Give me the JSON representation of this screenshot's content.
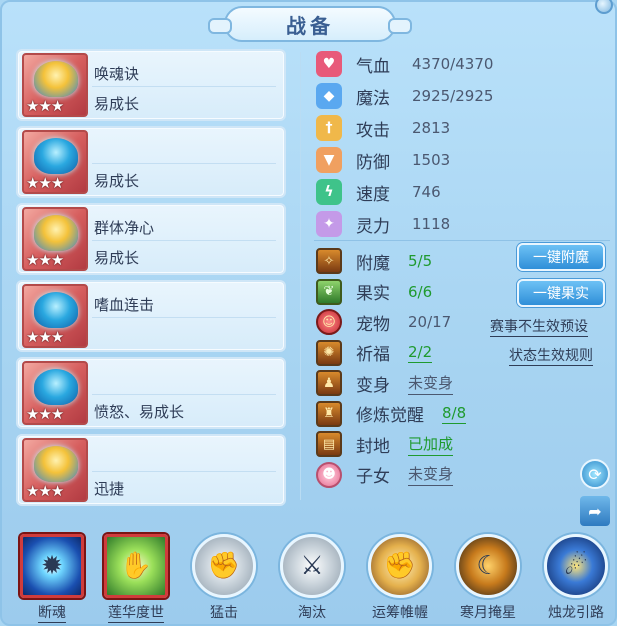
{
  "title": "战备",
  "mounts": [
    {
      "line1": "唤魂诀",
      "line2": "易成长",
      "stars": "★★★",
      "creature": "gold"
    },
    {
      "line1": "",
      "line2": "易成长",
      "stars": "★★★",
      "creature": "blue"
    },
    {
      "line1": "群体净心",
      "line2": "易成长",
      "stars": "★★★",
      "creature": "gold"
    },
    {
      "line1": "嗜血连击",
      "line2": "",
      "stars": "★★★",
      "creature": "blue"
    },
    {
      "line1": "",
      "line2": "愤怒、易成长",
      "stars": "★★★",
      "creature": "blue"
    },
    {
      "line1": "",
      "line2": "迅捷",
      "stars": "★★★",
      "creature": "gold"
    }
  ],
  "stats": [
    {
      "name": "气血",
      "value": "4370/4370",
      "icon": "heart-icon",
      "color": "#e85a7a",
      "glyph": "♥"
    },
    {
      "name": "魔法",
      "value": "2925/2925",
      "icon": "mana-icon",
      "color": "#5aa8f0",
      "glyph": "◆"
    },
    {
      "name": "攻击",
      "value": "2813",
      "icon": "sword-icon",
      "color": "#f0b84a",
      "glyph": "†"
    },
    {
      "name": "防御",
      "value": "1503",
      "icon": "shield-icon",
      "color": "#f0a060",
      "glyph": "▼"
    },
    {
      "name": "速度",
      "value": "746",
      "icon": "speed-icon",
      "color": "#3fc38a",
      "glyph": "ϟ"
    },
    {
      "name": "灵力",
      "value": "1118",
      "icon": "spirit-icon",
      "color": "#c49ae8",
      "glyph": "✦"
    }
  ],
  "extras": [
    {
      "name": "附魔",
      "value": "5/5",
      "style": "green",
      "icon": "enchant-icon",
      "glyph": "✧"
    },
    {
      "name": "果实",
      "value": "6/6",
      "style": "green",
      "icon": "fruit-icon",
      "glyph": "❦"
    },
    {
      "name": "宠物",
      "value": "20/17",
      "style": "grey",
      "icon": "pet-icon",
      "glyph": "☺"
    },
    {
      "name": "祈福",
      "value": "2/2",
      "style": "green-ul",
      "icon": "blessing-icon",
      "glyph": "✺"
    },
    {
      "name": "变身",
      "value": "未变身",
      "style": "grey-ul",
      "icon": "transform-icon",
      "glyph": "♟"
    },
    {
      "name": "修炼觉醒",
      "value": "8/8",
      "style": "green-ul",
      "icon": "awaken-icon",
      "glyph": "♜"
    },
    {
      "name": "封地",
      "value": "已加成",
      "style": "green-ul",
      "icon": "fief-icon",
      "glyph": "▤"
    },
    {
      "name": "子女",
      "value": "未变身",
      "style": "grey-ul",
      "icon": "child-icon",
      "glyph": "☻"
    }
  ],
  "buttons": {
    "enchant_all": "一键附魔",
    "fruit_all": "一键果实"
  },
  "links": {
    "event_preset": "赛事不生效预设",
    "status_rules": "状态生效规则"
  },
  "skills": [
    {
      "name": "断魂",
      "style": "square blue-core",
      "glyph": "✹",
      "underline": true
    },
    {
      "name": "莲华度世",
      "style": "square green-core",
      "glyph": "✋",
      "underline": true
    },
    {
      "name": "猛击",
      "style": "grey",
      "glyph": "✊",
      "underline": false
    },
    {
      "name": "淘汰",
      "style": "grey",
      "glyph": "⚔",
      "underline": false
    },
    {
      "name": "运筹帷幄",
      "style": "fist",
      "glyph": "✊",
      "underline": false
    },
    {
      "name": "寒月掩星",
      "style": "dark",
      "glyph": "☾",
      "underline": false
    },
    {
      "name": "烛龙引路",
      "style": "navy",
      "glyph": "☄",
      "underline": false
    }
  ]
}
